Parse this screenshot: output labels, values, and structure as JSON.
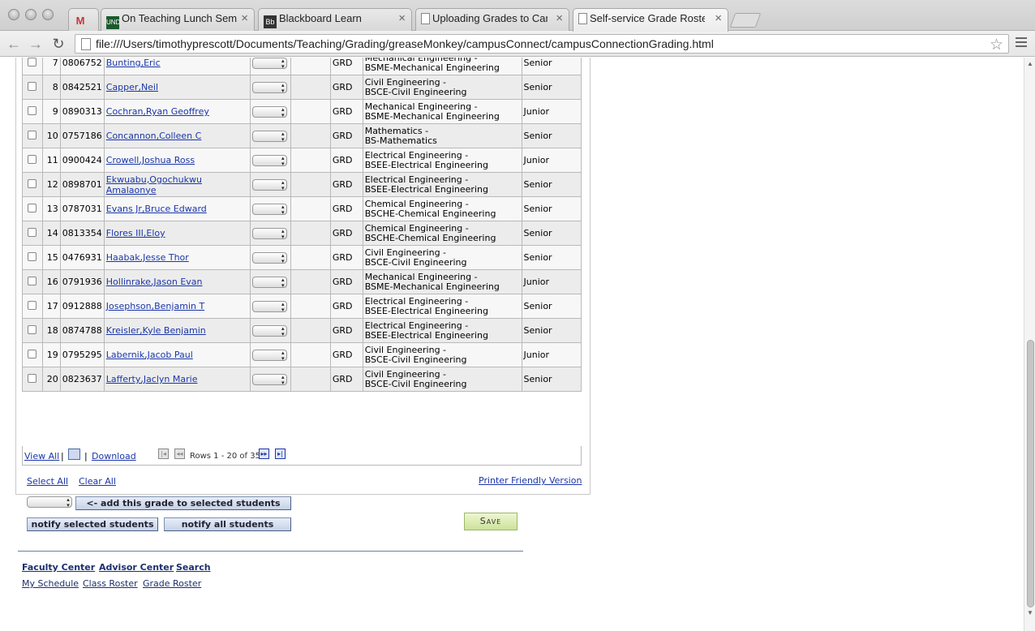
{
  "browser": {
    "tabs": [
      {
        "label": "",
        "icon": "gmail-icon"
      },
      {
        "label": "On Teaching Lunch Semin",
        "icon": "und-icon"
      },
      {
        "label": "Blackboard Learn",
        "icon": "blackboard-icon"
      },
      {
        "label": "Uploading Grades to Camp",
        "icon": "page-icon"
      },
      {
        "label": "Self-service Grade Roster",
        "icon": "page-icon"
      }
    ],
    "url": "file:///Users/timothyprescott/Documents/Teaching/Grading/greaseMonkey/campusConnect/campusConnectionGrading.html"
  },
  "roster": {
    "rows": [
      {
        "num": "7",
        "id": "0806752",
        "name": "Bunting,Eric",
        "grd": "GRD",
        "plan1": "Mechanical Engineering -",
        "plan2": "BSME-Mechanical Engineering",
        "level": "Senior"
      },
      {
        "num": "8",
        "id": "0842521",
        "name": "Capper,Neil",
        "grd": "GRD",
        "plan1": "Civil Engineering -",
        "plan2": "BSCE-Civil Engineering",
        "level": "Senior"
      },
      {
        "num": "9",
        "id": "0890313",
        "name": "Cochran,Ryan Geoffrey",
        "grd": "GRD",
        "plan1": "Mechanical Engineering -",
        "plan2": "BSME-Mechanical Engineering",
        "level": "Junior"
      },
      {
        "num": "10",
        "id": "0757186",
        "name": "Concannon,Colleen C",
        "grd": "GRD",
        "plan1": "Mathematics -",
        "plan2": "BS-Mathematics",
        "level": "Senior"
      },
      {
        "num": "11",
        "id": "0900424",
        "name": "Crowell,Joshua Ross",
        "grd": "GRD",
        "plan1": "Electrical Engineering -",
        "plan2": "BSEE-Electrical Engineering",
        "level": "Junior"
      },
      {
        "num": "12",
        "id": "0898701",
        "name": "Ekwuabu,Ogochukwu Amalaonye",
        "grd": "GRD",
        "plan1": "Electrical Engineering -",
        "plan2": "BSEE-Electrical Engineering",
        "level": "Senior"
      },
      {
        "num": "13",
        "id": "0787031",
        "name": "Evans Jr,Bruce Edward",
        "grd": "GRD",
        "plan1": "Chemical Engineering -",
        "plan2": "BSCHE-Chemical Engineering",
        "level": "Senior"
      },
      {
        "num": "14",
        "id": "0813354",
        "name": "Flores III,Eloy",
        "grd": "GRD",
        "plan1": "Chemical Engineering -",
        "plan2": "BSCHE-Chemical Engineering",
        "level": "Senior"
      },
      {
        "num": "15",
        "id": "0476931",
        "name": "Haabak,Jesse Thor",
        "grd": "GRD",
        "plan1": "Civil Engineering -",
        "plan2": "BSCE-Civil Engineering",
        "level": "Senior"
      },
      {
        "num": "16",
        "id": "0791936",
        "name": "Hollinrake,Jason Evan",
        "grd": "GRD",
        "plan1": "Mechanical Engineering -",
        "plan2": "BSME-Mechanical Engineering",
        "level": "Junior"
      },
      {
        "num": "17",
        "id": "0912888",
        "name": "Josephson,Benjamin T",
        "grd": "GRD",
        "plan1": "Electrical Engineering -",
        "plan2": "BSEE-Electrical Engineering",
        "level": "Senior"
      },
      {
        "num": "18",
        "id": "0874788",
        "name": "Kreisler,Kyle Benjamin",
        "grd": "GRD",
        "plan1": "Electrical Engineering -",
        "plan2": "BSEE-Electrical Engineering",
        "level": "Senior"
      },
      {
        "num": "19",
        "id": "0795295",
        "name": "Labernik,Jacob Paul",
        "grd": "GRD",
        "plan1": "Civil Engineering -",
        "plan2": "BSCE-Civil Engineering",
        "level": "Junior"
      },
      {
        "num": "20",
        "id": "0823637",
        "name": "Lafferty,Jaclyn Marie",
        "grd": "GRD",
        "plan1": "Civil Engineering -",
        "plan2": "BSCE-Civil Engineering",
        "level": "Senior"
      }
    ],
    "nav": {
      "view_all": "View All",
      "sep1": "|",
      "sep2": "|",
      "download": "Download",
      "rows_label": "Rows 1 - 20 of 35"
    }
  },
  "actions": {
    "select_all": "Select All",
    "clear_all": "Clear All",
    "printer_friendly": "Printer Friendly Version",
    "add_grade": "<- add this grade to selected students",
    "notify_selected": "notify selected students",
    "notify_all": "notify all students",
    "save": "Save"
  },
  "footer": {
    "faculty_center": "Faculty Center",
    "advisor_center": "Advisor Center",
    "search": "Search",
    "my_schedule": "My Schedule",
    "class_roster": "Class Roster",
    "grade_roster": "Grade Roster"
  }
}
